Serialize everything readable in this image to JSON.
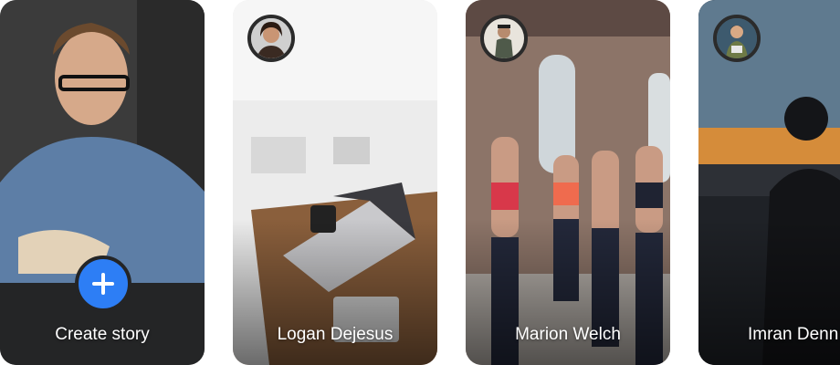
{
  "stories": {
    "create": {
      "label": "Create story",
      "button_color": "#2d7ef5",
      "icon": "plus-icon"
    },
    "items": [
      {
        "name": "Logan Dejesus",
        "avatar": "avatar-logan"
      },
      {
        "name": "Marion Welch",
        "avatar": "avatar-marion"
      },
      {
        "name": "Imran Denn",
        "avatar": "avatar-imran"
      }
    ]
  },
  "colors": {
    "dark_panel": "#242526",
    "avatar_ring": "#2b2b2b",
    "text": "#ffffff"
  }
}
